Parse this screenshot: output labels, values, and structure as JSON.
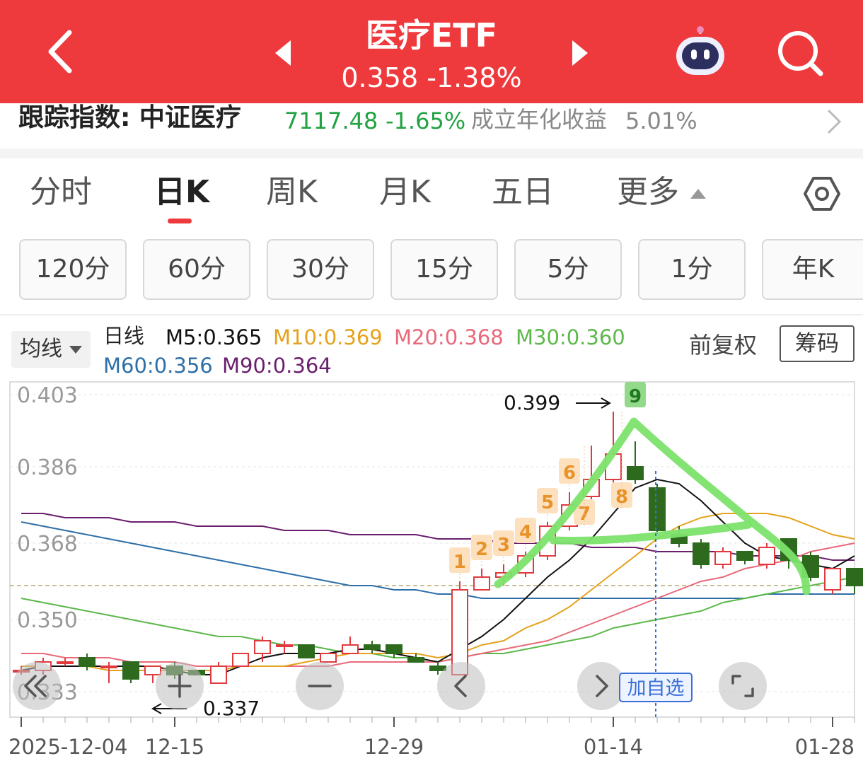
{
  "header": {
    "title": "医疗ETF",
    "price_line": "0.358  -1.38%"
  },
  "tracking": {
    "label": "跟踪指数: 中证医疗",
    "value": "7117.48",
    "change": "-1.65%",
    "yield_label": "成立年化收益",
    "yield_value": "5.01%"
  },
  "tabs": [
    {
      "label": "分时"
    },
    {
      "label": "日K"
    },
    {
      "label": "周K"
    },
    {
      "label": "月K"
    },
    {
      "label": "五日"
    },
    {
      "label": "更多"
    }
  ],
  "periods": [
    "120分",
    "60分",
    "30分",
    "15分",
    "5分",
    "1分",
    "年K"
  ],
  "legend": {
    "ma_select": "均线",
    "line_type": "日线",
    "items": [
      {
        "label": "M5:0.365",
        "color": "#111111"
      },
      {
        "label": "M10:0.369",
        "color": "#e5a21c"
      },
      {
        "label": "M20:0.368",
        "color": "#e86a7a"
      },
      {
        "label": "M30:0.360",
        "color": "#5cb84a"
      },
      {
        "label": "M60:0.356",
        "color": "#2e6fa8"
      },
      {
        "label": "M90:0.364",
        "color": "#6a1f6e"
      }
    ],
    "adjust": "前复权",
    "chips": "筹码"
  },
  "chart": {
    "y_ticks": [
      "0.403",
      "0.386",
      "0.368",
      "0.350",
      "0.333"
    ],
    "x_ticks": [
      "2025-12-04",
      "12-15",
      "12-29",
      "01-14",
      "01-28"
    ],
    "high_label": "0.399",
    "low_label": "0.337",
    "add_watch": "加自选",
    "seq_labels": [
      "1",
      "2",
      "3",
      "4",
      "5",
      "6",
      "7",
      "8",
      "9"
    ]
  },
  "chart_data": {
    "type": "candlestick",
    "ylim": [
      0.327,
      0.406
    ],
    "dates": [
      "2025-12-04",
      "12-05",
      "12-08",
      "12-09",
      "12-10",
      "12-11",
      "12-12",
      "12-15",
      "12-16",
      "12-17",
      "12-18",
      "12-19",
      "12-22",
      "12-23",
      "12-24",
      "12-25",
      "12-26",
      "12-29",
      "12-30",
      "12-31",
      "01-02",
      "01-05",
      "01-06",
      "01-07",
      "01-08",
      "01-09",
      "01-12",
      "01-13",
      "01-14",
      "01-15",
      "01-16",
      "01-19",
      "01-20",
      "01-21",
      "01-22",
      "01-23",
      "01-26",
      "01-27",
      "01-28"
    ],
    "candles": [
      {
        "o": 0.338,
        "c": 0.338,
        "h": 0.339,
        "l": 0.337
      },
      {
        "o": 0.338,
        "c": 0.34,
        "h": 0.341,
        "l": 0.337
      },
      {
        "o": 0.34,
        "c": 0.34,
        "h": 0.341,
        "l": 0.339
      },
      {
        "o": 0.341,
        "c": 0.339,
        "h": 0.342,
        "l": 0.338
      },
      {
        "o": 0.339,
        "c": 0.339,
        "h": 0.34,
        "l": 0.335
      },
      {
        "o": 0.34,
        "c": 0.336,
        "h": 0.34,
        "l": 0.335
      },
      {
        "o": 0.337,
        "c": 0.339,
        "h": 0.339,
        "l": 0.335
      },
      {
        "o": 0.339,
        "c": 0.337,
        "h": 0.34,
        "l": 0.336
      },
      {
        "o": 0.338,
        "c": 0.337,
        "h": 0.338,
        "l": 0.337
      },
      {
        "o": 0.335,
        "c": 0.339,
        "h": 0.34,
        "l": 0.335
      },
      {
        "o": 0.339,
        "c": 0.342,
        "h": 0.342,
        "l": 0.339
      },
      {
        "o": 0.342,
        "c": 0.345,
        "h": 0.346,
        "l": 0.34
      },
      {
        "o": 0.344,
        "c": 0.344,
        "h": 0.345,
        "l": 0.342
      },
      {
        "o": 0.344,
        "c": 0.341,
        "h": 0.344,
        "l": 0.341
      },
      {
        "o": 0.34,
        "c": 0.342,
        "h": 0.342,
        "l": 0.34
      },
      {
        "o": 0.342,
        "c": 0.344,
        "h": 0.346,
        "l": 0.342
      },
      {
        "o": 0.344,
        "c": 0.343,
        "h": 0.345,
        "l": 0.342
      },
      {
        "o": 0.344,
        "c": 0.342,
        "h": 0.344,
        "l": 0.341
      },
      {
        "o": 0.341,
        "c": 0.34,
        "h": 0.342,
        "l": 0.34
      },
      {
        "o": 0.339,
        "c": 0.338,
        "h": 0.34,
        "l": 0.337
      },
      {
        "o": 0.337,
        "c": 0.357,
        "h": 0.359,
        "l": 0.337
      },
      {
        "o": 0.357,
        "c": 0.36,
        "h": 0.362,
        "l": 0.357
      },
      {
        "o": 0.36,
        "c": 0.361,
        "h": 0.363,
        "l": 0.358
      },
      {
        "o": 0.361,
        "c": 0.365,
        "h": 0.366,
        "l": 0.36
      },
      {
        "o": 0.365,
        "c": 0.372,
        "h": 0.373,
        "l": 0.364
      },
      {
        "o": 0.372,
        "c": 0.377,
        "h": 0.38,
        "l": 0.371
      },
      {
        "o": 0.379,
        "c": 0.383,
        "h": 0.391,
        "l": 0.378
      },
      {
        "o": 0.383,
        "c": 0.389,
        "h": 0.399,
        "l": 0.382
      },
      {
        "o": 0.386,
        "c": 0.383,
        "h": 0.392,
        "l": 0.382
      },
      {
        "o": 0.381,
        "c": 0.371,
        "h": 0.382,
        "l": 0.37
      },
      {
        "o": 0.37,
        "c": 0.368,
        "h": 0.372,
        "l": 0.367
      },
      {
        "o": 0.368,
        "c": 0.363,
        "h": 0.369,
        "l": 0.362
      },
      {
        "o": 0.363,
        "c": 0.366,
        "h": 0.367,
        "l": 0.362
      },
      {
        "o": 0.366,
        "c": 0.364,
        "h": 0.366,
        "l": 0.363
      },
      {
        "o": 0.363,
        "c": 0.367,
        "h": 0.368,
        "l": 0.362
      },
      {
        "o": 0.369,
        "c": 0.364,
        "h": 0.369,
        "l": 0.362
      },
      {
        "o": 0.365,
        "c": 0.36,
        "h": 0.366,
        "l": 0.359
      },
      {
        "o": 0.357,
        "c": 0.362,
        "h": 0.362,
        "l": 0.356
      },
      {
        "o": 0.362,
        "c": 0.358,
        "h": 0.362,
        "l": 0.356
      }
    ],
    "ma": {
      "M5": [
        0.338,
        0.339,
        0.339,
        0.339,
        0.339,
        0.339,
        0.339,
        0.338,
        0.337,
        0.337,
        0.339,
        0.341,
        0.342,
        0.342,
        0.342,
        0.343,
        0.343,
        0.342,
        0.341,
        0.34,
        0.343,
        0.346,
        0.35,
        0.355,
        0.36,
        0.364,
        0.369,
        0.375,
        0.381,
        0.383,
        0.382,
        0.378,
        0.373,
        0.368,
        0.365,
        0.364,
        0.363,
        0.362,
        0.365
      ],
      "M10": [
        0.339,
        0.339,
        0.339,
        0.339,
        0.338,
        0.338,
        0.338,
        0.338,
        0.338,
        0.338,
        0.339,
        0.339,
        0.339,
        0.34,
        0.341,
        0.342,
        0.342,
        0.342,
        0.342,
        0.341,
        0.342,
        0.344,
        0.345,
        0.348,
        0.35,
        0.353,
        0.357,
        0.361,
        0.365,
        0.369,
        0.372,
        0.374,
        0.375,
        0.375,
        0.375,
        0.374,
        0.372,
        0.37,
        0.369
      ],
      "M20": [
        0.342,
        0.342,
        0.341,
        0.341,
        0.341,
        0.34,
        0.34,
        0.34,
        0.339,
        0.339,
        0.339,
        0.339,
        0.339,
        0.339,
        0.339,
        0.34,
        0.34,
        0.34,
        0.34,
        0.34,
        0.341,
        0.342,
        0.343,
        0.344,
        0.345,
        0.347,
        0.349,
        0.351,
        0.353,
        0.355,
        0.357,
        0.359,
        0.36,
        0.362,
        0.363,
        0.364,
        0.366,
        0.367,
        0.368
      ],
      "M30": [
        0.355,
        0.354,
        0.353,
        0.352,
        0.351,
        0.35,
        0.349,
        0.348,
        0.347,
        0.346,
        0.346,
        0.345,
        0.344,
        0.344,
        0.343,
        0.342,
        0.342,
        0.341,
        0.341,
        0.34,
        0.341,
        0.342,
        0.342,
        0.343,
        0.344,
        0.345,
        0.346,
        0.348,
        0.349,
        0.35,
        0.351,
        0.352,
        0.354,
        0.355,
        0.356,
        0.357,
        0.358,
        0.359,
        0.36
      ],
      "M60": [
        0.373,
        0.372,
        0.371,
        0.37,
        0.369,
        0.368,
        0.367,
        0.366,
        0.365,
        0.364,
        0.363,
        0.362,
        0.361,
        0.36,
        0.359,
        0.358,
        0.358,
        0.357,
        0.357,
        0.356,
        0.356,
        0.355,
        0.355,
        0.355,
        0.355,
        0.355,
        0.355,
        0.355,
        0.355,
        0.355,
        0.355,
        0.355,
        0.355,
        0.355,
        0.356,
        0.356,
        0.356,
        0.356,
        0.356
      ],
      "M90": [
        0.375,
        0.375,
        0.374,
        0.374,
        0.374,
        0.373,
        0.373,
        0.373,
        0.372,
        0.372,
        0.372,
        0.372,
        0.371,
        0.371,
        0.371,
        0.37,
        0.37,
        0.37,
        0.37,
        0.369,
        0.369,
        0.369,
        0.368,
        0.368,
        0.368,
        0.368,
        0.367,
        0.367,
        0.367,
        0.366,
        0.366,
        0.366,
        0.366,
        0.365,
        0.365,
        0.365,
        0.365,
        0.364,
        0.364
      ]
    }
  }
}
